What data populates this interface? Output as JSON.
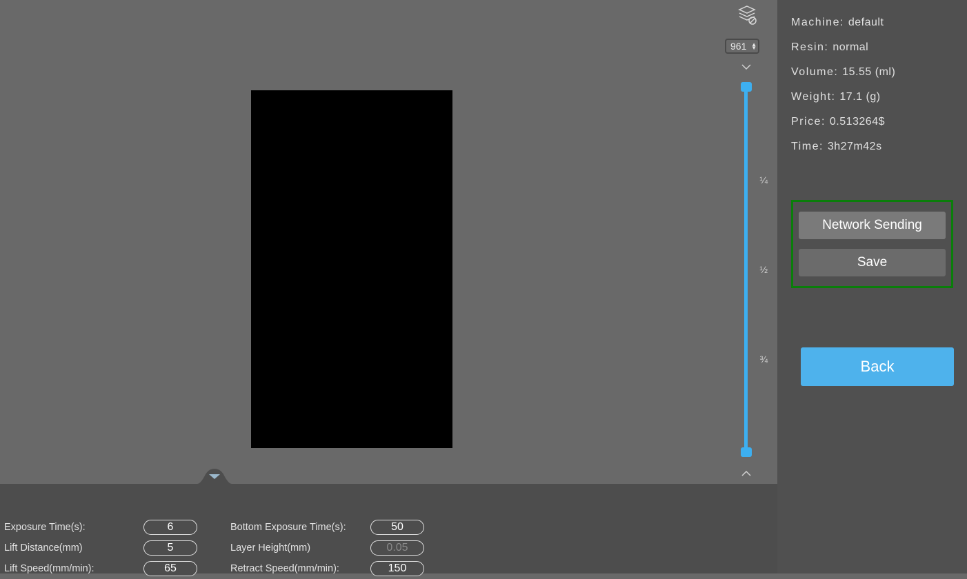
{
  "info": {
    "machine_label": "Machine:",
    "machine_value": "default",
    "resin_label": "Resin:",
    "resin_value": "normal",
    "volume_label": "Volume:",
    "volume_value": "15.55 (ml)",
    "weight_label": "Weight:",
    "weight_value": "17.1 (g)",
    "price_label": "Price:",
    "price_value": "0.513264$",
    "time_label": "Time:",
    "time_value": "3h27m42s"
  },
  "buttons": {
    "network_sending": "Network Sending",
    "save": "Save",
    "back": "Back"
  },
  "slider": {
    "current_layer": "961",
    "frac_14": "¼",
    "frac_12": "½",
    "frac_34": "¾"
  },
  "params": {
    "exposure_time_label": "Exposure Time(s):",
    "exposure_time_value": "6",
    "lift_distance_label": "Lift Distance(mm)",
    "lift_distance_value": "5",
    "lift_speed_label": "Lift Speed(mm/min):",
    "lift_speed_value": "65",
    "bottom_exposure_label": "Bottom Exposure Time(s):",
    "bottom_exposure_value": "50",
    "layer_height_label": "Layer Height(mm)",
    "layer_height_value": "0.05",
    "retract_speed_label": "Retract Speed(mm/min):",
    "retract_speed_value": "150"
  }
}
